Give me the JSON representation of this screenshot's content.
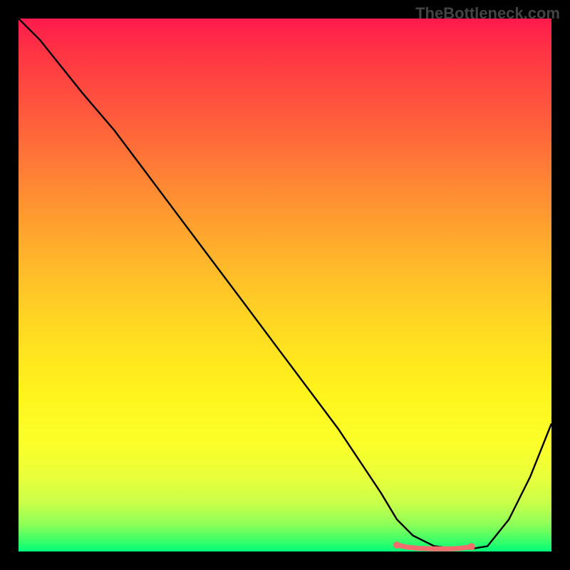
{
  "watermark": "TheBottleneck.com",
  "chart_data": {
    "type": "line",
    "title": "",
    "xlabel": "",
    "ylabel": "",
    "xlim": [
      0,
      100
    ],
    "ylim": [
      0,
      100
    ],
    "series": [
      {
        "name": "bottleneck-curve",
        "x": [
          0,
          4,
          8,
          12,
          18,
          24,
          30,
          36,
          42,
          48,
          54,
          60,
          64,
          68,
          71,
          74,
          78,
          82,
          85,
          88,
          92,
          96,
          100
        ],
        "y": [
          100,
          96,
          91,
          86,
          79,
          71,
          63,
          55,
          47,
          39,
          31,
          23,
          17,
          11,
          6,
          3,
          1,
          0.5,
          0.5,
          1,
          6,
          14,
          24
        ]
      },
      {
        "name": "optimal-band-marker",
        "x": [
          71,
          73,
          75,
          78,
          81,
          83,
          85
        ],
        "y": [
          1.2,
          0.8,
          0.6,
          0.5,
          0.5,
          0.6,
          0.9
        ]
      }
    ],
    "gradient_stops": [
      {
        "pos": 0,
        "color": "#ff1a4d"
      },
      {
        "pos": 50,
        "color": "#ffd922"
      },
      {
        "pos": 80,
        "color": "#fbff2a"
      },
      {
        "pos": 100,
        "color": "#00ff78"
      }
    ]
  }
}
